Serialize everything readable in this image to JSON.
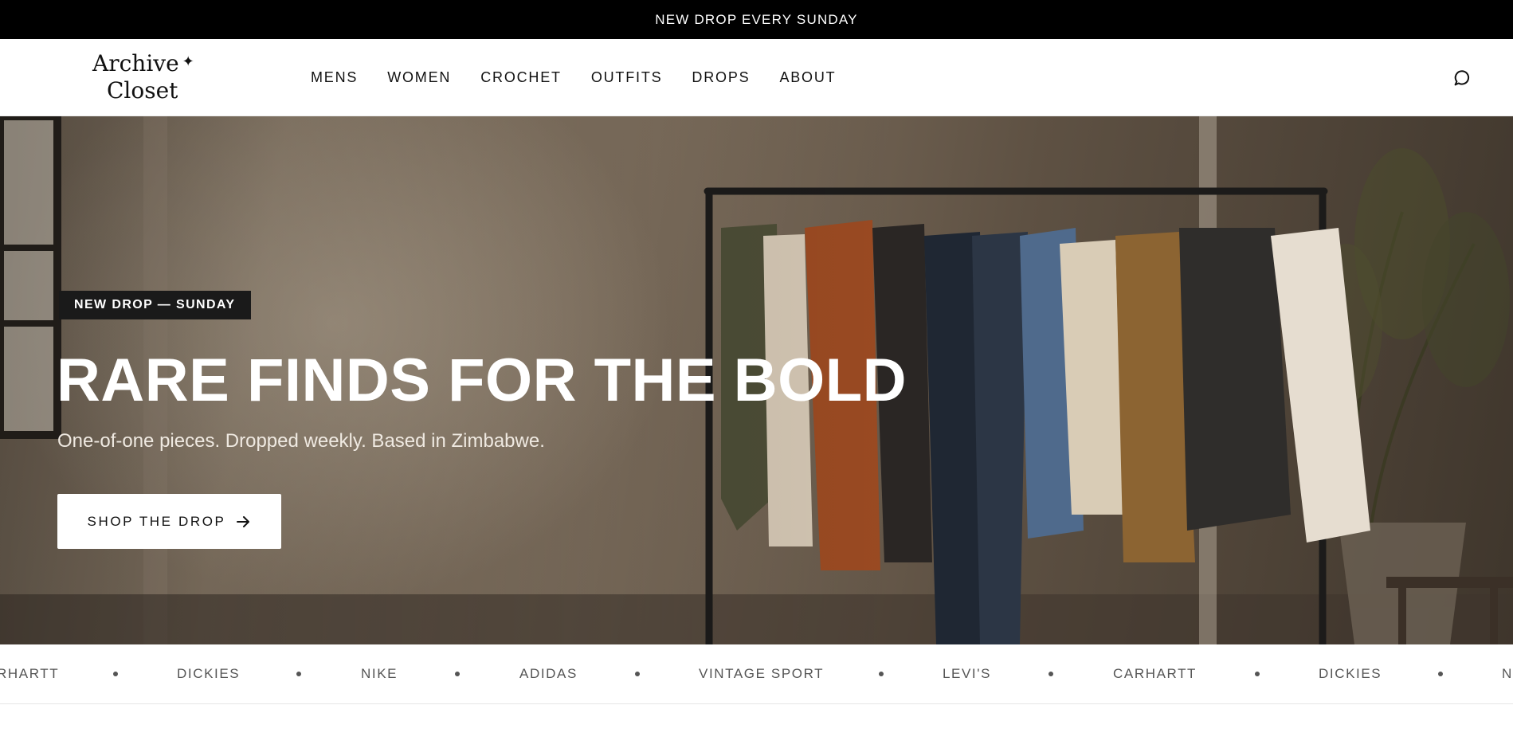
{
  "announcement": {
    "text": "NEW DROP EVERY SUNDAY"
  },
  "header": {
    "logo": {
      "line1": "Archive",
      "line2": "Closet",
      "mark": "✦"
    },
    "nav": [
      "MENS",
      "WOMEN",
      "CROCHET",
      "OUTFITS",
      "DROPS",
      "ABOUT"
    ],
    "search_icon": "search-icon"
  },
  "hero": {
    "badge": "NEW DROP — SUNDAY",
    "title": "RARE FINDS FOR THE BOLD",
    "subtitle": "One-of-one pieces. Dropped weekly. Based in Zimbabwe.",
    "cta_label": "SHOP THE DROP",
    "cta_icon": "arrow-right-icon",
    "image": "clothing-rack-photo"
  },
  "brands": {
    "items": [
      "RHARTT",
      "DICKIES",
      "NIKE",
      "ADIDAS",
      "VINTAGE SPORT",
      "LEVI'S",
      "CARHARTT",
      "DICKIES",
      "N"
    ]
  },
  "colors": {
    "announcement_bg": "#000000",
    "cta_bg": "#ffffff",
    "badge_bg": "#1a1a1a"
  }
}
